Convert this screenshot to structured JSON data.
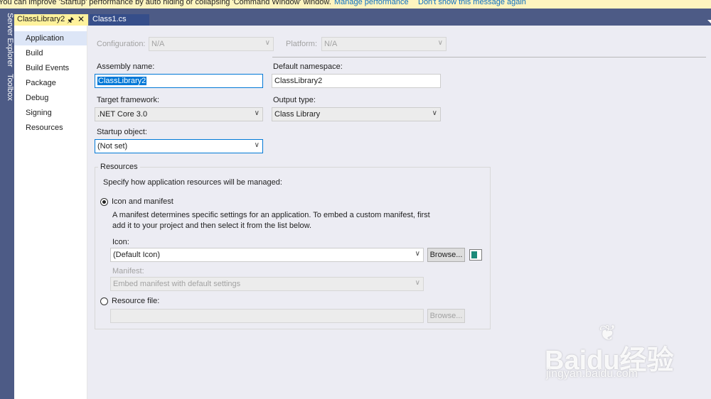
{
  "infobar": {
    "message": "You can improve 'Startup' performance by auto hiding or collapsing 'Command Window' window.",
    "link_manage": "Manage performance",
    "link_dismiss": "Don't show this message again"
  },
  "left_strip": {
    "server_explorer": "Server Explorer",
    "toolbox": "Toolbox"
  },
  "tabs": [
    {
      "label": "ClassLibrary2",
      "pin_icon": "pin-icon",
      "close_icon": "close-icon",
      "active": true
    },
    {
      "label": "Class1.cs",
      "active": false
    }
  ],
  "sidenav": {
    "items": [
      {
        "label": "Application",
        "selected": true
      },
      {
        "label": "Build"
      },
      {
        "label": "Build Events"
      },
      {
        "label": "Package"
      },
      {
        "label": "Debug"
      },
      {
        "label": "Signing"
      },
      {
        "label": "Resources"
      }
    ]
  },
  "top": {
    "configuration_label": "Configuration:",
    "configuration_value": "N/A",
    "platform_label": "Platform:",
    "platform_value": "N/A"
  },
  "app": {
    "assembly_name_label": "Assembly name:",
    "assembly_name_value": "ClassLibrary2",
    "default_namespace_label": "Default namespace:",
    "default_namespace_value": "ClassLibrary2",
    "target_framework_label": "Target framework:",
    "target_framework_value": ".NET Core 3.0",
    "output_type_label": "Output type:",
    "output_type_value": "Class Library",
    "startup_object_label": "Startup object:",
    "startup_object_value": "(Not set)"
  },
  "resources": {
    "group_title": "Resources",
    "description": "Specify how application resources will be managed:",
    "icon_manifest_label": "Icon and manifest",
    "manifest_desc_line1": "A manifest determines specific settings for an application. To embed a custom manifest, first",
    "manifest_desc_line2": "add it to your project and then select it from the list below.",
    "icon_label": "Icon:",
    "icon_value": "(Default Icon)",
    "browse_label": "Browse...",
    "manifest_label": "Manifest:",
    "manifest_value": "Embed manifest with default settings",
    "resource_file_label": "Resource file:",
    "resource_browse_label": "Browse..."
  },
  "watermark": {
    "brand": "Baidu经验",
    "url": "jingyan.baidu.com"
  },
  "colors": {
    "accent": "#0078d7",
    "chrome": "#4d5b86",
    "active_tab": "#fff29d",
    "content_bg": "#ececf3"
  }
}
